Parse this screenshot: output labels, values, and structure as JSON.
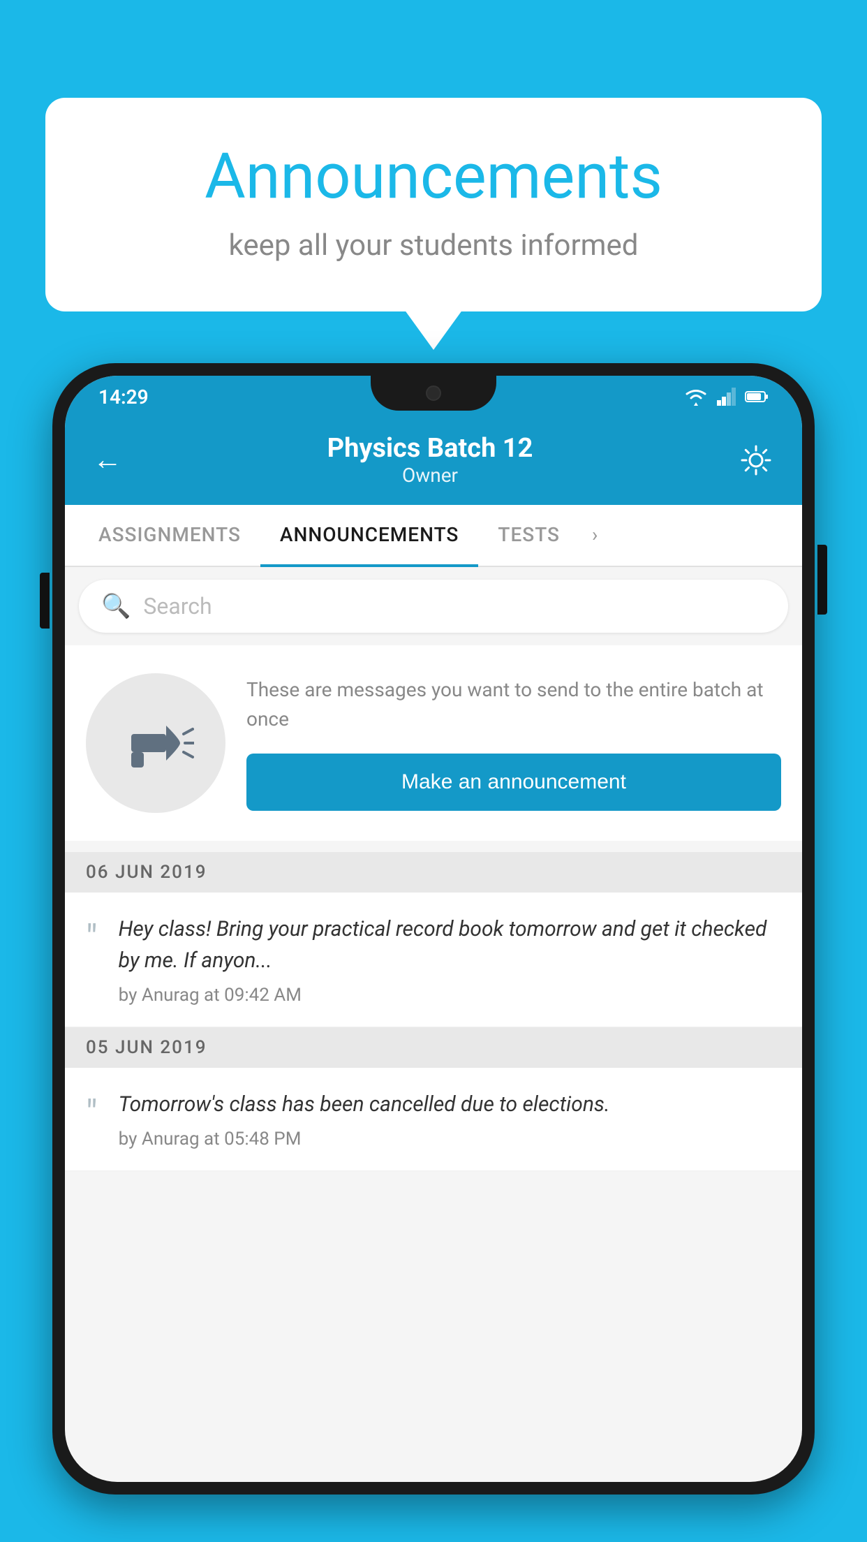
{
  "bubble": {
    "title": "Announcements",
    "subtitle": "keep all your students informed"
  },
  "phone": {
    "status_bar": {
      "time": "14:29"
    },
    "header": {
      "title": "Physics Batch 12",
      "subtitle": "Owner",
      "back_label": "←",
      "gear_label": "⚙"
    },
    "tabs": [
      {
        "label": "ASSIGNMENTS",
        "active": false
      },
      {
        "label": "ANNOUNCEMENTS",
        "active": true
      },
      {
        "label": "TESTS",
        "active": false
      },
      {
        "label": "›",
        "active": false
      }
    ],
    "search": {
      "placeholder": "Search"
    },
    "promo": {
      "description": "These are messages you want to send to the entire batch at once",
      "cta": "Make an announcement"
    },
    "announcements": [
      {
        "date": "06  JUN  2019",
        "text": "Hey class! Bring your practical record book tomorrow and get it checked by me. If anyon...",
        "meta": "by Anurag at 09:42 AM"
      },
      {
        "date": "05  JUN  2019",
        "text": "Tomorrow's class has been cancelled due to elections.",
        "meta": "by Anurag at 05:48 PM"
      }
    ]
  },
  "colors": {
    "background": "#1BB8E8",
    "header_bg": "#1499c8",
    "bubble_title": "#1BB8E8",
    "btn_bg": "#1499c8"
  }
}
